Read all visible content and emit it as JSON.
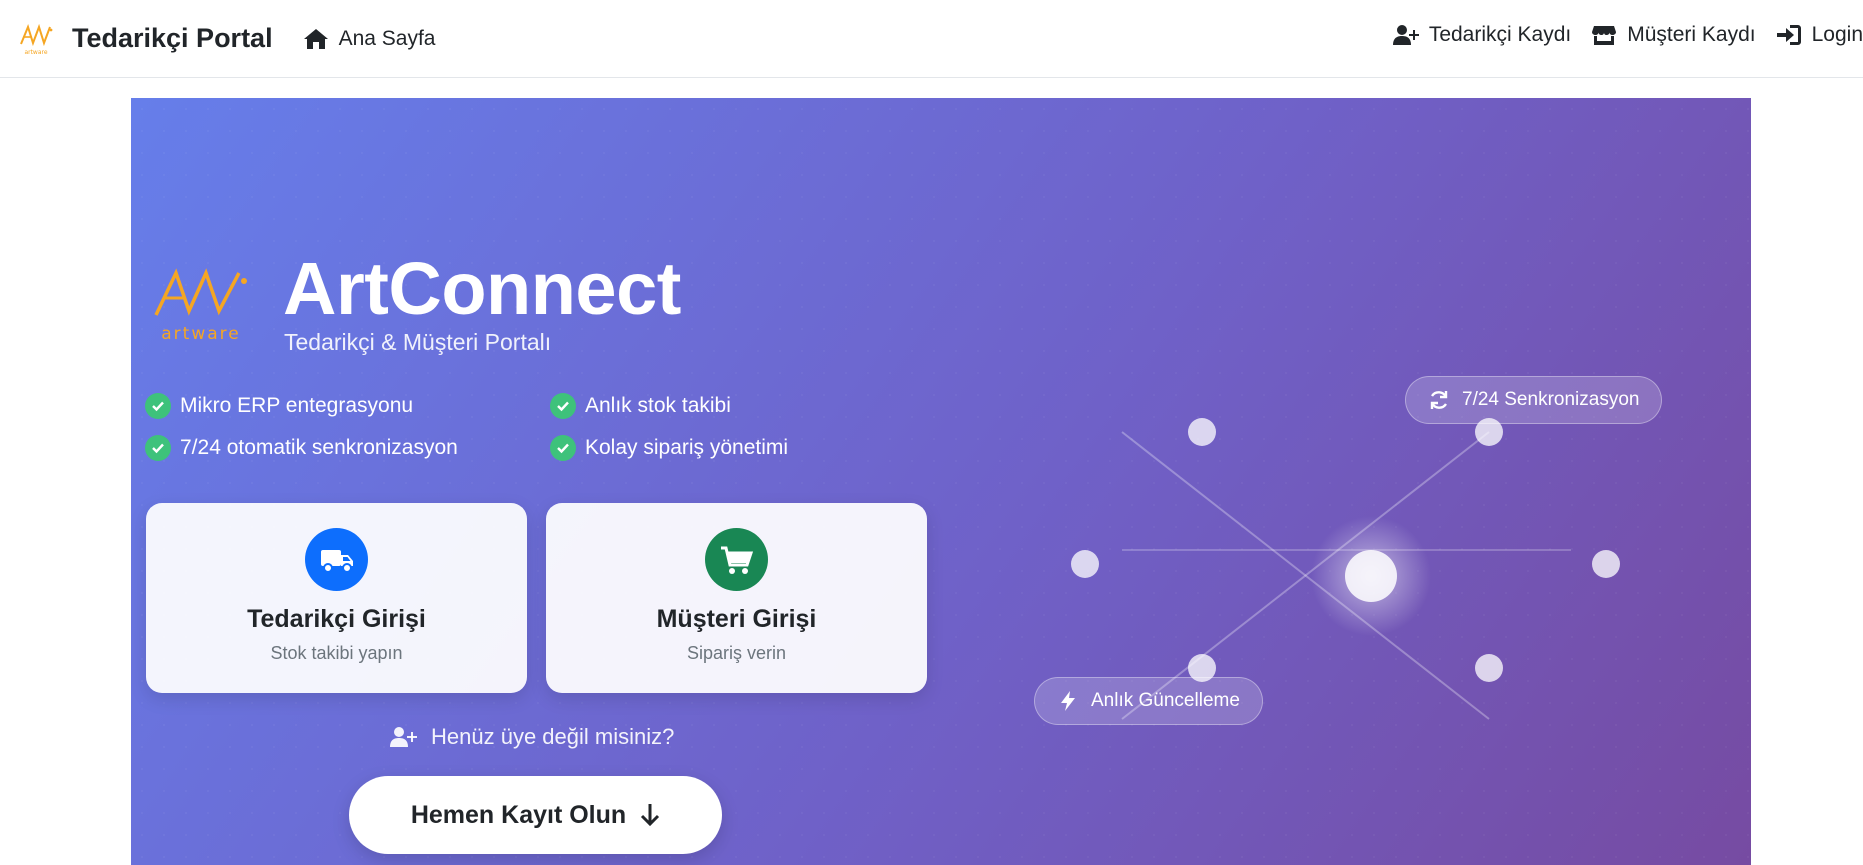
{
  "navbar": {
    "brand_title": "Tedarikçi Portal",
    "brand_logo_text": "artware",
    "home_label": "Ana Sayfa",
    "links": [
      {
        "label": "Tedarikçi Kaydı",
        "icon": "user-plus-icon"
      },
      {
        "label": "Müşteri Kaydı",
        "icon": "store-icon"
      },
      {
        "label": "Login",
        "icon": "sign-in-icon"
      }
    ]
  },
  "hero": {
    "logo_text": "artware",
    "title": "ArtConnect",
    "subtitle": "Tedarikçi & Müşteri Portalı",
    "features": [
      "Mikro ERP entegrasyonu",
      "Anlık stok takibi",
      "7/24 otomatik senkronizasyon",
      "Kolay sipariş yönetimi"
    ],
    "cards": [
      {
        "title": "Tedarikçi Girişi",
        "subtitle": "Stok takibi yapın",
        "icon": "truck-icon",
        "color": "#0d6efd"
      },
      {
        "title": "Müşteri Girişi",
        "subtitle": "Sipariş verin",
        "icon": "cart-icon",
        "color": "#198754"
      }
    ],
    "register_prompt": "Henüz üye değil misiniz?",
    "register_button": "Hemen Kayıt Olun",
    "badges": [
      {
        "label": "7/24 Senkronizasyon",
        "icon": "sync-icon"
      },
      {
        "label": "Anlık Güncelleme",
        "icon": "bolt-icon"
      }
    ]
  },
  "colors": {
    "gradient_start": "#667eea",
    "gradient_end": "#764ba2",
    "check": "#3ec27b",
    "logo_orange": "#f5a623"
  }
}
